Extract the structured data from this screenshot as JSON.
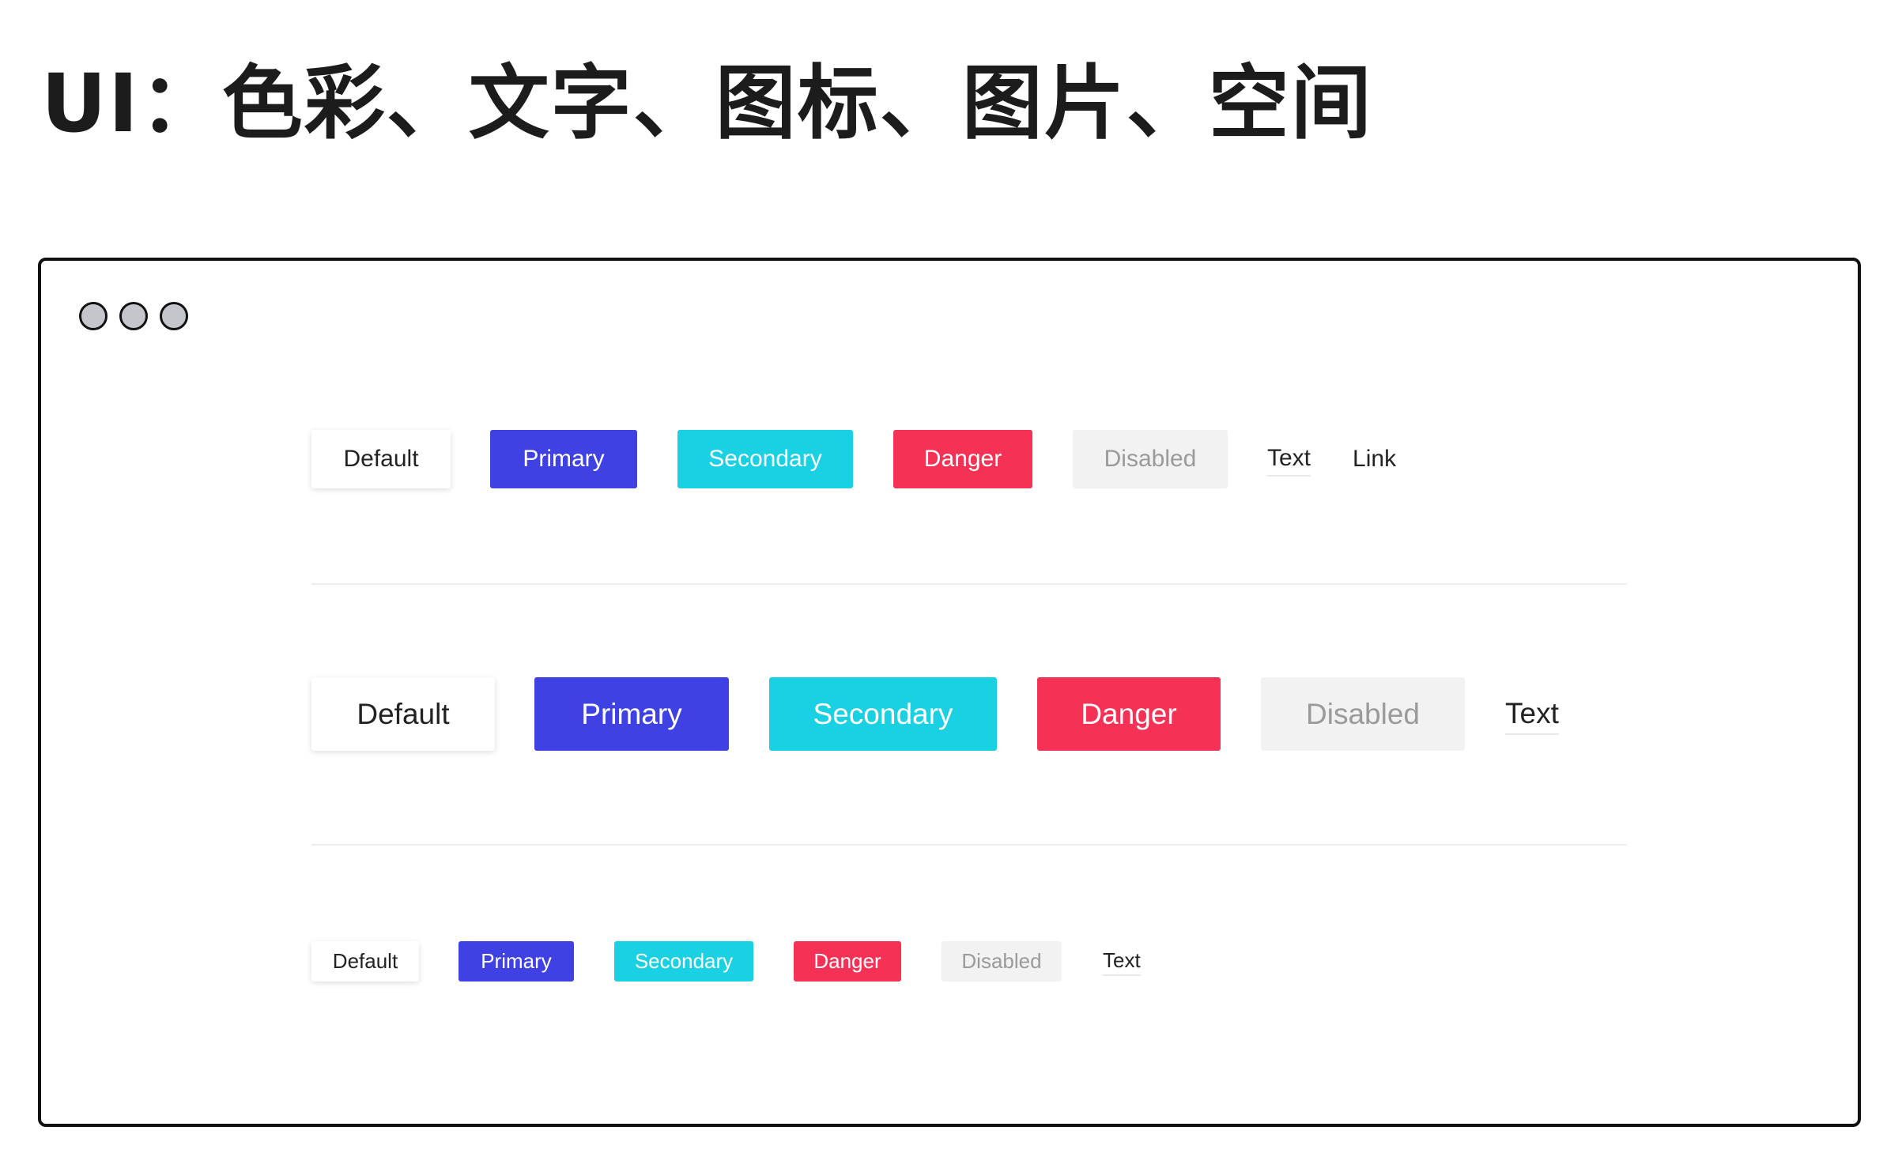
{
  "page": {
    "title": "UI：色彩、文字、图标、图片、空间"
  },
  "window": {
    "controls": [
      "window-dot",
      "window-dot",
      "window-dot"
    ]
  },
  "colors": {
    "primary": "#3f41e2",
    "secondary": "#1ad0e3",
    "danger": "#f53256",
    "disabled_bg": "#f2f2f2",
    "disabled_text": "#9a9a9a",
    "dot": "#c4c6cc"
  },
  "rows": {
    "medium": {
      "default": "Default",
      "primary": "Primary",
      "secondary": "Secondary",
      "danger": "Danger",
      "disabled": "Disabled",
      "text": "Text",
      "link": "Link"
    },
    "large": {
      "default": "Default",
      "primary": "Primary",
      "secondary": "Secondary",
      "danger": "Danger",
      "disabled": "Disabled",
      "text": "Text"
    },
    "small": {
      "default": "Default",
      "primary": "Primary",
      "secondary": "Secondary",
      "danger": "Danger",
      "disabled": "Disabled",
      "text": "Text"
    }
  }
}
